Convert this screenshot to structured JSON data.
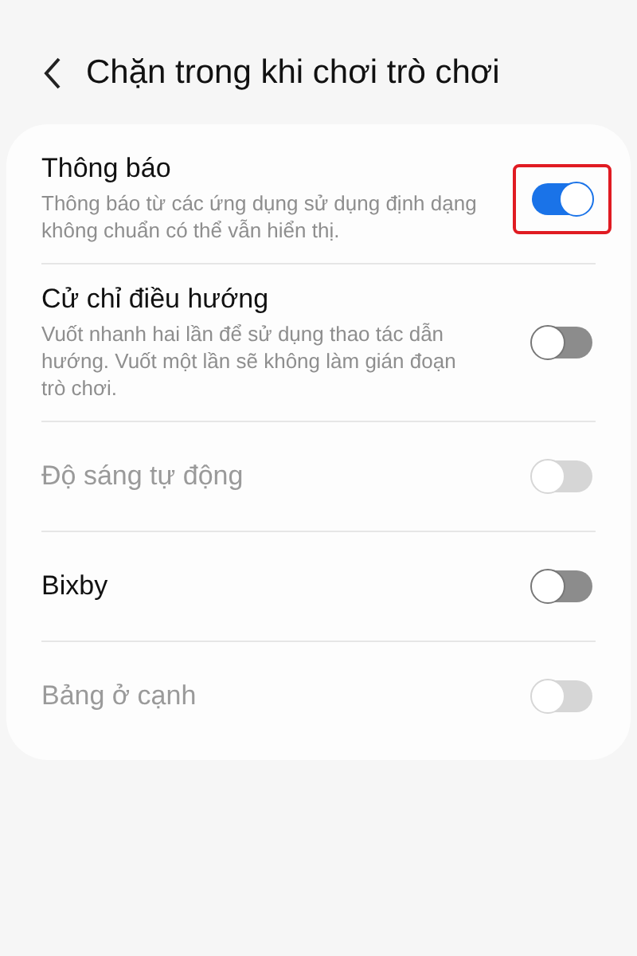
{
  "header": {
    "title": "Chặn trong khi chơi trò chơi"
  },
  "settings": [
    {
      "label": "Thông báo",
      "description": "Thông báo từ các ứng dụng sử dụng định dạng không chuẩn có thể vẫn hiển thị.",
      "on": true,
      "disabled": false,
      "highlighted": true
    },
    {
      "label": "Cử chỉ điều hướng",
      "description": "Vuốt nhanh hai lần để sử dụng thao tác dẫn hướng. Vuốt một lần sẽ không làm gián đoạn trò chơi.",
      "on": false,
      "disabled": false,
      "highlighted": false
    },
    {
      "label": "Độ sáng tự động",
      "on": false,
      "disabled": true,
      "highlighted": false
    },
    {
      "label": "Bixby",
      "on": false,
      "disabled": false,
      "highlighted": false
    },
    {
      "label": "Bảng ở cạnh",
      "on": false,
      "disabled": true,
      "highlighted": false
    }
  ]
}
